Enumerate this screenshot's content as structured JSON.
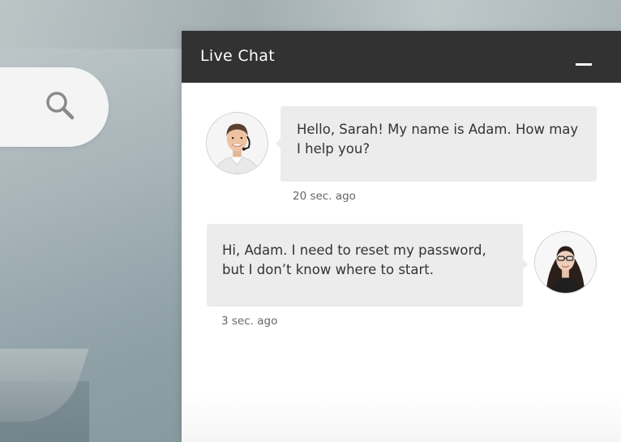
{
  "chat": {
    "title": "Live Chat",
    "messages": [
      {
        "sender": "Adam",
        "text": "Hello, Sarah! My name is Adam. How may I help you?",
        "time": "20 sec. ago"
      },
      {
        "sender": "Sarah",
        "text": "Hi, Adam. I need to reset my password, but I don’t know where to start.",
        "time": "3 sec. ago"
      }
    ]
  },
  "icons": {
    "search": "search-icon",
    "minimize": "minimize-icon"
  },
  "colors": {
    "header_bg": "#323232",
    "bubble_bg": "#ececec",
    "panel_bg": "#ffffff",
    "text": "#333333"
  }
}
